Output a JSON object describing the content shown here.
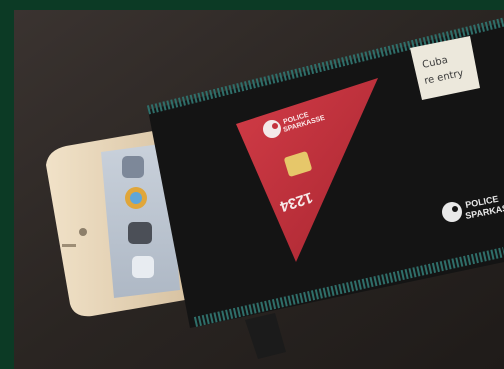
{
  "photo": {
    "frame_color": "#0c3a25",
    "table_color": "#2a2522",
    "sleeve_color": "#141414",
    "thread_color": "#2f6f6a",
    "card_color": "#c4323d",
    "phone_color": "#e6d3b6"
  },
  "card": {
    "brand_line1": "POLICE",
    "brand_line2": "SPARKASSE",
    "number": "1234",
    "logo": "bank-bird-logo"
  },
  "sleeve": {
    "brand_line1": "POLICE",
    "brand_line2": "SPARKASSE",
    "logo": "bank-bird-logo"
  },
  "sticky_note": {
    "line1": "Cuba",
    "line2": "re entry"
  }
}
